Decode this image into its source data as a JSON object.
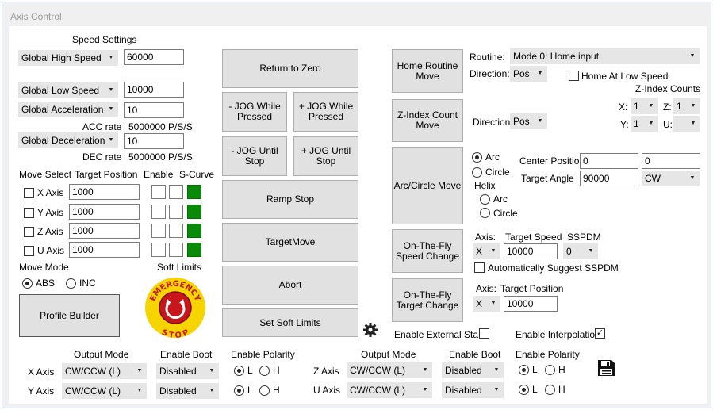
{
  "window": {
    "title": "Axis Control"
  },
  "speed": {
    "heading": "Speed Settings",
    "high": {
      "label": "Global High Speed",
      "value": "60000"
    },
    "low": {
      "label": "Global Low Speed",
      "value": "10000"
    },
    "acc": {
      "label": "Global Acceleration",
      "value": "10",
      "rate_label": "ACC rate",
      "rate_value": "5000000 P/S/S"
    },
    "dec": {
      "label": "Global Deceleration",
      "value": "10",
      "rate_label": "DEC rate",
      "rate_value": "5000000 P/S/S"
    }
  },
  "moves": {
    "hdr_select": "Move Select",
    "hdr_target": "Target Position",
    "hdr_enable": "Enable",
    "hdr_scurve": "S-Curve",
    "rows": [
      {
        "label": "X Axis",
        "value": "1000"
      },
      {
        "label": "Y Axis",
        "value": "1000"
      },
      {
        "label": "Z Axis",
        "value": "1000"
      },
      {
        "label": "U Axis",
        "value": "1000"
      }
    ]
  },
  "move_mode": {
    "label": "Move Mode",
    "abs": "ABS",
    "inc": "INC",
    "selected": "ABS"
  },
  "soft_limits": {
    "label": "Soft Limits"
  },
  "estop": {
    "top": "EMERGENCY",
    "bottom": "STOP"
  },
  "buttons": {
    "profile_builder": "Profile Builder",
    "return_zero": "Return to Zero",
    "jog_minus_while": "- JOG  While Pressed",
    "jog_plus_while": "+ JOG While Pressed",
    "jog_minus_until": "- JOG Until Stop",
    "jog_plus_until": "+ JOG Until Stop",
    "ramp_stop": "Ramp Stop",
    "target_move": "TargetMove",
    "abort": "Abort",
    "set_soft_limits": "Set Soft Limits",
    "home_routine": "Home Routine Move",
    "zindex_move": "Z-Index Count Move",
    "arc_move": "Arc/Circle Move",
    "otf_speed": "On-The-Fly Speed Change",
    "otf_target": "On-The-Fly Target Change"
  },
  "home": {
    "routine_label": "Routine:",
    "routine_value": "Mode 0: Home input",
    "direction_label": "Direction:",
    "direction_value": "Pos",
    "low_speed_label": "Home At Low Speed"
  },
  "zindex": {
    "heading": "Z-Index Counts",
    "x_label": "X:",
    "x_value": "1",
    "z_label": "Z:",
    "z_value": "1",
    "y_label": "Y:",
    "y_value": "1",
    "u_label": "U:",
    "u_value": "",
    "direction_label": "Direction:",
    "direction_value": "Pos"
  },
  "arc": {
    "arc_label": "Arc",
    "circle_label": "Circle",
    "helix_label": "Helix",
    "helix_arc": "Arc",
    "helix_circle": "Circle",
    "center_label": "Center Position",
    "center_x": "0",
    "center_y": "0",
    "angle_label": "Target Angle",
    "angle_value": "90000",
    "dir_value": "CW"
  },
  "otf_speed": {
    "axis_label": "Axis:",
    "axis_value": "X",
    "speed_label": "Target Speed",
    "speed_value": "10000",
    "sspdm_label": "SSPDM",
    "sspdm_value": "0",
    "suggest_label": "Automatically Suggest SSPDM"
  },
  "otf_target": {
    "axis_label": "Axis:",
    "axis_value": "X",
    "target_label": "Target Position",
    "target_value": "10000"
  },
  "external": {
    "start_label": "Enable External Start",
    "interp_label": "Enable Interpolation",
    "interp_checked": true
  },
  "output": {
    "hdr_mode": "Output Mode",
    "hdr_boot": "Enable Boot",
    "hdr_polarity": "Enable Polarity",
    "l": "L",
    "h": "H",
    "axes": [
      {
        "label": "X Axis",
        "mode": "CW/CCW (L)",
        "boot": "Disabled"
      },
      {
        "label": "Y Axis",
        "mode": "CW/CCW (L)",
        "boot": "Disabled"
      },
      {
        "label": "Z Axis",
        "mode": "CW/CCW (L)",
        "boot": "Disabled"
      },
      {
        "label": "U Axis",
        "mode": "CW/CCW (L)",
        "boot": "Disabled"
      }
    ]
  },
  "icons": {
    "settings": "gear-icon",
    "save": "floppy-disk-icon",
    "estop": "emergency-stop-icon"
  }
}
